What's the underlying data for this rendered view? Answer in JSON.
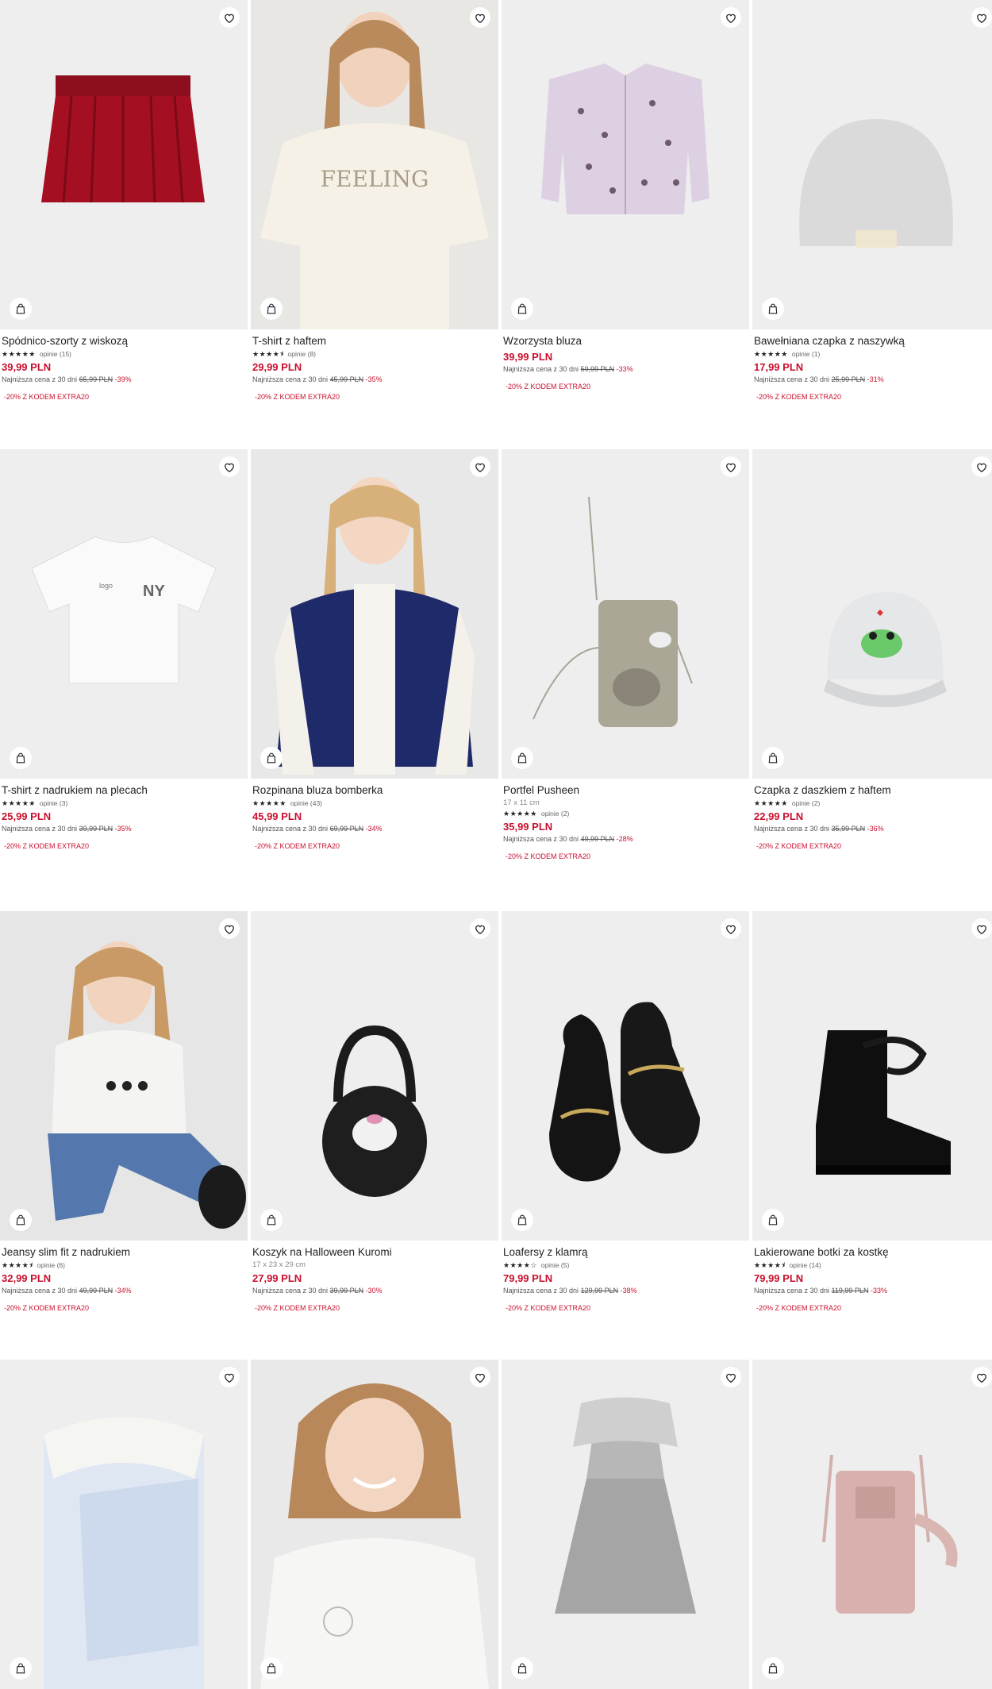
{
  "colors": {
    "price": "#c8102e",
    "image_bg": "#eeeeee",
    "text": "#222222"
  },
  "rows": [
    {
      "products": [
        {
          "name": "Spódnico-szorty z wiskozą",
          "stars": "★★★★★",
          "reviews": "opinie (15)",
          "price": "39,99 PLN",
          "lowest_prefix": "Najniższa cena z 30 dni",
          "old_price": "65,99 PLN",
          "discount": "-39%",
          "promo": "-20% Z KODEM EXTRA20",
          "art": "skirt"
        },
        {
          "name": "T-shirt z haftem",
          "stars": "★★★★⯨",
          "reviews": "opinie (8)",
          "price": "29,99 PLN",
          "lowest_prefix": "Najniższa cena z 30 dni",
          "old_price": "45,99 PLN",
          "discount": "-35%",
          "promo": "-20% Z KODEM EXTRA20",
          "art": "girl-tee"
        },
        {
          "name": "Wzorzysta bluza",
          "price": "39,99 PLN",
          "lowest_prefix": "Najniższa cena z 30 dni",
          "old_price": "59,99 PLN",
          "discount": "-33%",
          "promo": "-20% Z KODEM EXTRA20",
          "art": "jacket"
        },
        {
          "name": "Bawełniana czapka z naszywką",
          "stars": "★★★★★",
          "reviews": "opinie (1)",
          "price": "17,99 PLN",
          "lowest_prefix": "Najniższa cena z 30 dni",
          "old_price": "25,99 PLN",
          "discount": "-31%",
          "promo": "-20% Z KODEM EXTRA20",
          "art": "beanie"
        }
      ]
    },
    {
      "products": [
        {
          "name": "T-shirt z nadrukiem na plecach",
          "stars": "★★★★★",
          "reviews": "opinie (3)",
          "price": "25,99 PLN",
          "lowest_prefix": "Najniższa cena z 30 dni",
          "old_price": "39,99 PLN",
          "discount": "-35%",
          "promo": "-20% Z KODEM EXTRA20",
          "art": "tee"
        },
        {
          "name": "Rozpinana bluza bomberka",
          "stars": "★★★★★",
          "reviews": "opinie (43)",
          "price": "45,99 PLN",
          "lowest_prefix": "Najniższa cena z 30 dni",
          "old_price": "69,99 PLN",
          "discount": "-34%",
          "promo": "-20% Z KODEM EXTRA20",
          "art": "bomber"
        },
        {
          "name": "Portfel Pusheen",
          "dims": "17 x 11 cm",
          "stars": "★★★★★",
          "reviews": "opinie (2)",
          "price": "35,99 PLN",
          "lowest_prefix": "Najniższa cena z 30 dni",
          "old_price": "49,99 PLN",
          "discount": "-28%",
          "promo": "-20% Z KODEM EXTRA20",
          "art": "wallet"
        },
        {
          "name": "Czapka z daszkiem z haftem",
          "stars": "★★★★★",
          "reviews": "opinie (2)",
          "price": "22,99 PLN",
          "lowest_prefix": "Najniższa cena z 30 dni",
          "old_price": "35,99 PLN",
          "discount": "-36%",
          "promo": "-20% Z KODEM EXTRA20",
          "art": "cap"
        }
      ]
    },
    {
      "products": [
        {
          "name": "Jeansy slim fit z nadrukiem",
          "stars": "★★★★⯨",
          "reviews": "opinie (6)",
          "price": "32,99 PLN",
          "lowest_prefix": "Najniższa cena z 30 dni",
          "old_price": "49,99 PLN",
          "discount": "-34%",
          "promo": "-20% Z KODEM EXTRA20",
          "art": "jeans"
        },
        {
          "name": "Koszyk na Halloween Kuromi",
          "dims": "17 x 23 x 29 cm",
          "price": "27,99 PLN",
          "lowest_prefix": "Najniższa cena z 30 dni",
          "old_price": "39,99 PLN",
          "discount": "-30%",
          "promo": "-20% Z KODEM EXTRA20",
          "art": "basket"
        },
        {
          "name": "Loafersy z klamrą",
          "stars": "★★★★☆",
          "reviews": "opinie (5)",
          "price": "79,99 PLN",
          "lowest_prefix": "Najniższa cena z 30 dni",
          "old_price": "129,99 PLN",
          "discount": "-38%",
          "promo": "-20% Z KODEM EXTRA20",
          "art": "loafers"
        },
        {
          "name": "Lakierowane botki za kostkę",
          "stars": "★★★★⯨",
          "reviews": "opinie (14)",
          "price": "79,99 PLN",
          "lowest_prefix": "Najniższa cena z 30 dni",
          "old_price": "119,99 PLN",
          "discount": "-33%",
          "promo": "-20% Z KODEM EXTRA20",
          "art": "boots"
        }
      ]
    },
    {
      "products": [
        {
          "art": "towel"
        },
        {
          "art": "sweatshirt"
        },
        {
          "art": "dress"
        },
        {
          "art": "bag"
        }
      ]
    }
  ]
}
